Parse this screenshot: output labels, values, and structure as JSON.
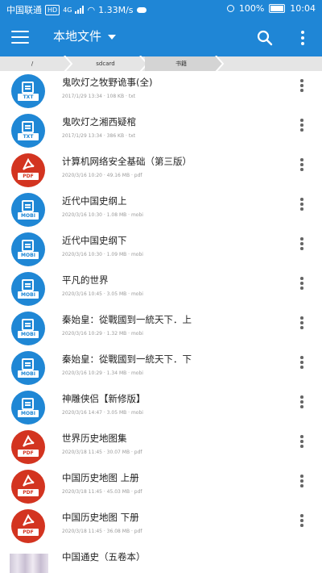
{
  "status_bar": {
    "carrier": "中国联通",
    "hd": "HD",
    "network": "4G",
    "speed": "1.33M/s",
    "battery": "100%",
    "time": "10:04"
  },
  "app_bar": {
    "title": "本地文件"
  },
  "breadcrumb": [
    "/",
    "sdcard",
    "书籍"
  ],
  "colors": {
    "primary": "#1f86d6",
    "mobi_icon": "#1f87d5",
    "pdf_icon": "#d33420"
  },
  "files": [
    {
      "name": "鬼吹灯之牧野诡事(全)",
      "meta": "2017/1/29 13:34 · 108 KB · txt",
      "type": "TXT",
      "icon": "text-file-icon"
    },
    {
      "name": "鬼吹灯之湘西疑棺",
      "meta": "2017/1/29 13:34 · 386 KB · txt",
      "type": "TXT",
      "icon": "text-file-icon"
    },
    {
      "name": "计算机网络安全基础（第三版）",
      "meta": "2020/3/16 10:20 · 49.16 MB · pdf",
      "type": "PDF",
      "icon": "pdf-file-icon"
    },
    {
      "name": "近代中国史纲上",
      "meta": "2020/3/16 10:30 · 1.08 MB · mobi",
      "type": "MOBI",
      "icon": "mobi-file-icon"
    },
    {
      "name": "近代中国史纲下",
      "meta": "2020/3/16 10:30 · 1.09 MB · mobi",
      "type": "MOBI",
      "icon": "mobi-file-icon"
    },
    {
      "name": "平凡的世界",
      "meta": "2020/3/16 10:45 · 3.05 MB · mobi",
      "type": "MOBI",
      "icon": "mobi-file-icon"
    },
    {
      "name": "秦始皇：從戰國到一統天下．上",
      "meta": "2020/3/16 10:29 · 1.32 MB · mobi",
      "type": "MOBI",
      "icon": "mobi-file-icon"
    },
    {
      "name": "秦始皇：從戰國到一統天下．下",
      "meta": "2020/3/16 10:29 · 1.34 MB · mobi",
      "type": "MOBI",
      "icon": "mobi-file-icon"
    },
    {
      "name": "神雕侠侣【新修版】",
      "meta": "2020/3/16 14:47 · 3.05 MB · mobi",
      "type": "MOBI",
      "icon": "mobi-file-icon"
    },
    {
      "name": "世界历史地图集",
      "meta": "2020/3/18 11:45 · 30.07 MB · pdf",
      "type": "PDF",
      "icon": "pdf-file-icon"
    },
    {
      "name": "中国历史地图 上册",
      "meta": "2020/3/18 11:45 · 45.03 MB · pdf",
      "type": "PDF",
      "icon": "pdf-file-icon"
    },
    {
      "name": "中国历史地图 下册",
      "meta": "2020/3/18 11:45 · 36.08 MB · pdf",
      "type": "PDF",
      "icon": "pdf-file-icon"
    },
    {
      "name": "中国通史（五卷本）",
      "meta": "",
      "type": "",
      "icon": "book-cover-thumbnail"
    }
  ]
}
